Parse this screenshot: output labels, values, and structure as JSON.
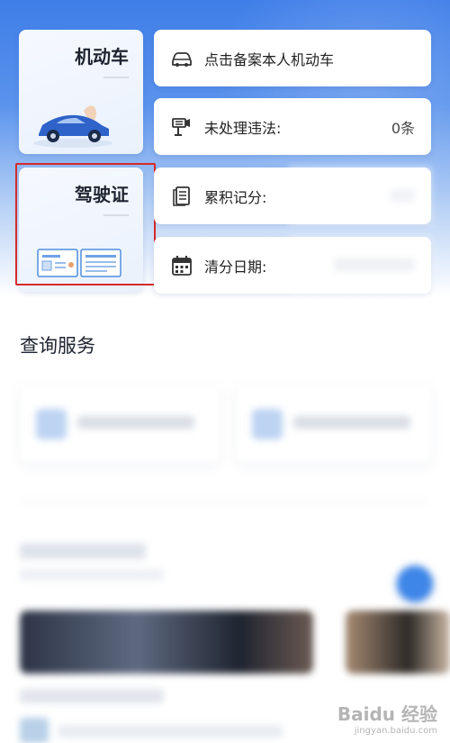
{
  "vehicle_tile": {
    "title": "机动车"
  },
  "license_tile": {
    "title": "驾驶证"
  },
  "rows": {
    "register": {
      "label": "点击备案本人机动车",
      "icon": "car-outline-icon"
    },
    "violations": {
      "label": "未处理违法:",
      "value": "0条",
      "icon": "camera-icon"
    },
    "points": {
      "label": "累积记分:",
      "icon": "document-icon"
    },
    "clear_date": {
      "label": "清分日期:",
      "icon": "calendar-icon"
    }
  },
  "services": {
    "title": "查询服务"
  },
  "watermark": {
    "brand": "Baidu 经验",
    "url": "jingyan.baidu.com"
  },
  "colors": {
    "accent": "#3f7ee8",
    "highlight": "#d42b2b"
  }
}
